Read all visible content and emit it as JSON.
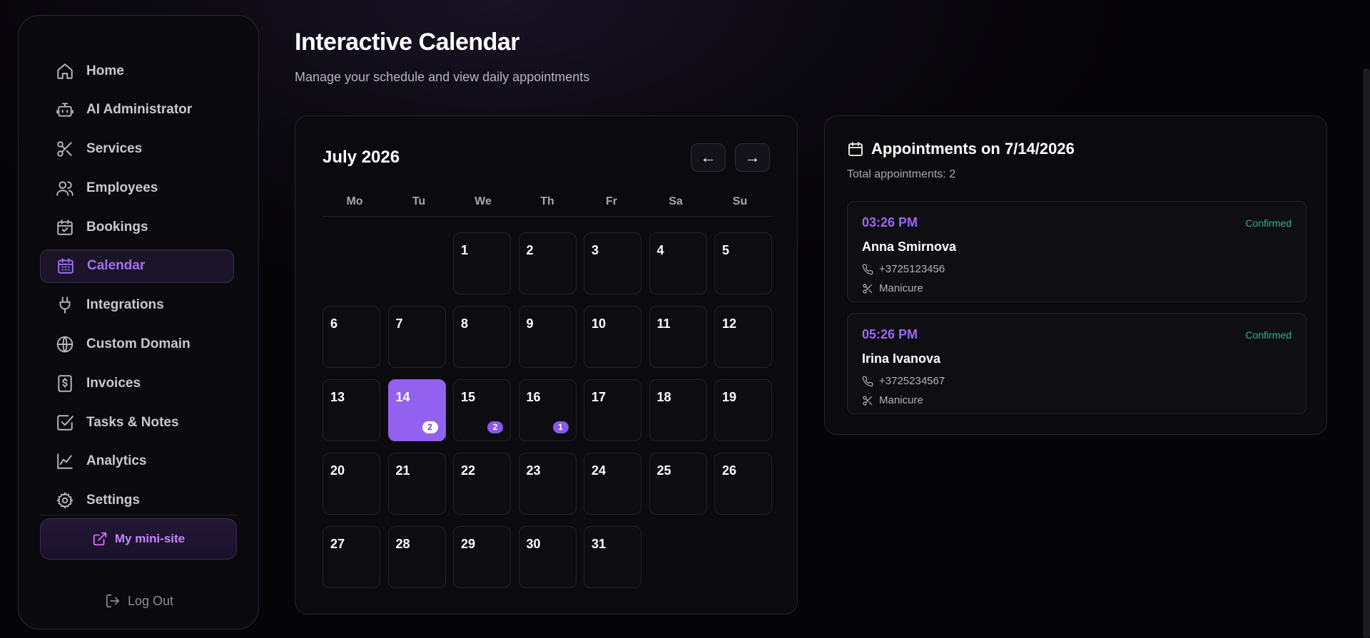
{
  "sidebar": {
    "items": [
      {
        "label": "Home",
        "icon": "home-icon",
        "active": false
      },
      {
        "label": "AI Administrator",
        "icon": "bot-icon",
        "active": false
      },
      {
        "label": "Services",
        "icon": "scissors-icon",
        "active": false
      },
      {
        "label": "Employees",
        "icon": "users-icon",
        "active": false
      },
      {
        "label": "Bookings",
        "icon": "calendar-check-icon",
        "active": false
      },
      {
        "label": "Calendar",
        "icon": "calendar-grid-icon",
        "active": true
      },
      {
        "label": "Integrations",
        "icon": "plug-icon",
        "active": false
      },
      {
        "label": "Custom Domain",
        "icon": "globe-icon",
        "active": false
      },
      {
        "label": "Invoices",
        "icon": "receipt-icon",
        "active": false
      },
      {
        "label": "Tasks & Notes",
        "icon": "check-square-icon",
        "active": false
      },
      {
        "label": "Analytics",
        "icon": "chart-line-icon",
        "active": false
      },
      {
        "label": "Settings",
        "icon": "gear-icon",
        "active": false
      }
    ],
    "minisite_label": "My mini-site",
    "logout_label": "Log Out"
  },
  "header": {
    "title": "Interactive Calendar",
    "subtitle": "Manage your schedule and view daily appointments"
  },
  "calendar": {
    "month_label": "July 2026",
    "prev_label": "←",
    "next_label": "→",
    "weekdays": [
      "Mo",
      "Tu",
      "We",
      "Th",
      "Fr",
      "Sa",
      "Su"
    ],
    "leading_blanks": 2,
    "days_in_month": 31,
    "selected_day": 14,
    "booking_counts": {
      "14": 2,
      "15": 2,
      "16": 1
    }
  },
  "appointments": {
    "title": "Appointments on 7/14/2026",
    "total_label": "Total appointments: 2",
    "items": [
      {
        "time": "03:26 PM",
        "status": "Confirmed",
        "name": "Anna Smirnova",
        "phone": "+3725123456",
        "service": "Manicure"
      },
      {
        "time": "05:26 PM",
        "status": "Confirmed",
        "name": "Irina Ivanova",
        "phone": "+3725234567",
        "service": "Manicure"
      }
    ]
  },
  "colors": {
    "accent": "#9361f0",
    "confirmed": "#2fb877",
    "background": "#07060a"
  }
}
